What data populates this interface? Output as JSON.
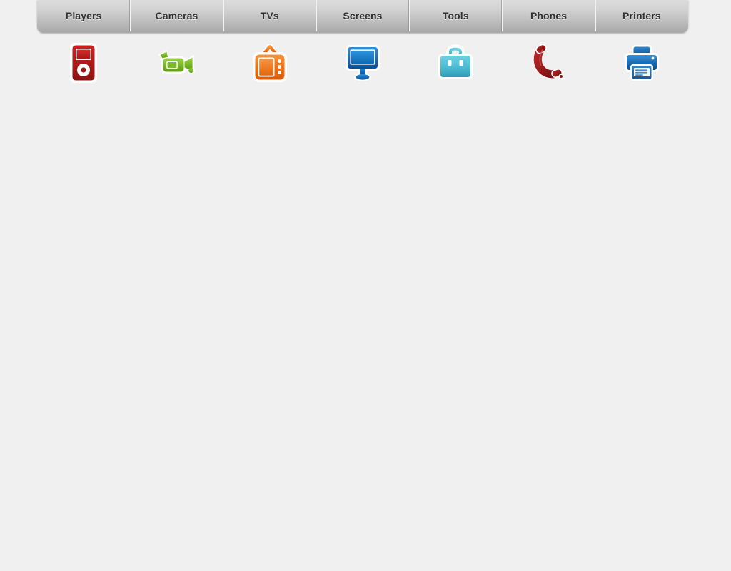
{
  "window": {
    "background_color": "#f0f0f0"
  },
  "tabbar": {
    "selected_index": null,
    "tabs": [
      {
        "label": "Players",
        "icon": "media-player-icon",
        "icon_color": "#b01f1f"
      },
      {
        "label": "Cameras",
        "icon": "video-camera-icon",
        "icon_color": "#76bb21"
      },
      {
        "label": "TVs",
        "icon": "television-icon",
        "icon_color": "#ef7415"
      },
      {
        "label": "Screens",
        "icon": "monitor-icon",
        "icon_color": "#0f6fc6"
      },
      {
        "label": "Tools",
        "icon": "briefcase-icon",
        "icon_color": "#57c2d6"
      },
      {
        "label": "Phones",
        "icon": "telephone-icon",
        "icon_color": "#9f1f1f"
      },
      {
        "label": "Printers",
        "icon": "printer-icon",
        "icon_color": "#1768b5"
      }
    ]
  },
  "content": {
    "body_text": ""
  }
}
